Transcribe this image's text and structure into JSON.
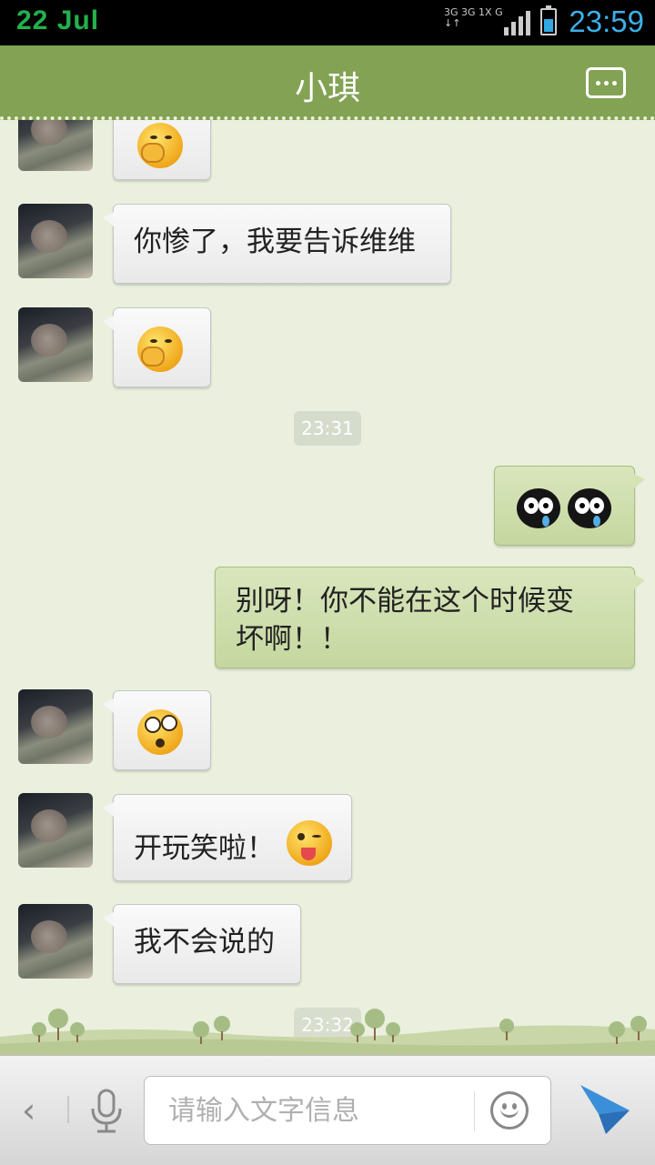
{
  "status_bar": {
    "date": "22 Jul",
    "time": "23:59",
    "network": [
      "3G 3G 1X G",
      "↓↑"
    ]
  },
  "header": {
    "title": "小琪",
    "more_icon": "more-dots-icon"
  },
  "messages": [
    {
      "side": "in",
      "type": "emoji",
      "emoji": "shy-face-icon"
    },
    {
      "side": "in",
      "type": "text",
      "text": "你惨了，我要告诉维维"
    },
    {
      "side": "in",
      "type": "emoji",
      "emoji": "shy-face-icon"
    },
    {
      "type": "time",
      "text": "23:31"
    },
    {
      "side": "out",
      "type": "emoji",
      "emoji": "crying-black-face-icon x2"
    },
    {
      "side": "out",
      "type": "text",
      "text_line1": "别呀！你不能在这个时候变",
      "text_line2": "坏啊！！"
    },
    {
      "side": "in",
      "type": "emoji",
      "emoji": "dizzy-face-icon"
    },
    {
      "side": "in",
      "type": "text",
      "text": "开玩笑啦！",
      "emoji": "tongue-wink-face-icon"
    },
    {
      "side": "in",
      "type": "text",
      "text": "我不会说的"
    },
    {
      "type": "time",
      "text": "23:32"
    }
  ],
  "input_bar": {
    "back_label": "‹",
    "placeholder": "请输入文字信息"
  },
  "colors": {
    "header_bg": "#83a254",
    "chat_bg": "#eaf0dd",
    "out_bubble": "#cfe0ad",
    "time_blue": "#3cb0e8"
  }
}
